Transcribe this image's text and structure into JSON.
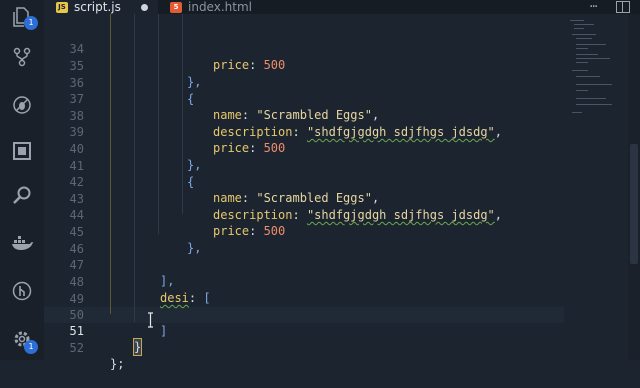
{
  "tabs": [
    {
      "label": "script.js",
      "icon": "js-icon",
      "badge": "JS",
      "active": true,
      "modified": true
    },
    {
      "label": "index.html",
      "icon": "html-icon",
      "badge": "5",
      "active": false
    }
  ],
  "activity_bar": {
    "explorer_badge": "1",
    "settings_badge": "1",
    "icons": [
      "files-icon",
      "source-control-icon",
      "debug-icon",
      "extensions-icon",
      "search-icon",
      "docker-icon",
      "git-lens-icon",
      "settings-gear-icon"
    ]
  },
  "editor": {
    "current_line": "51",
    "lines": [
      {
        "num": "34",
        "indent": 2
      },
      {
        "num": "35",
        "indent": 1
      },
      {
        "num": "36",
        "indent": 1
      },
      {
        "num": "37",
        "indent": 2
      },
      {
        "num": "38",
        "indent": 2
      },
      {
        "num": "39",
        "indent": 2
      },
      {
        "num": "40",
        "indent": 1
      },
      {
        "num": "41",
        "indent": 1
      },
      {
        "num": "42",
        "indent": 2
      },
      {
        "num": "43",
        "indent": 2
      },
      {
        "num": "44",
        "indent": 2
      },
      {
        "num": "45",
        "indent": 1
      },
      {
        "num": "46",
        "indent": 0
      },
      {
        "num": "47",
        "indent": 0
      },
      {
        "num": "48",
        "indent": 0
      },
      {
        "num": "49",
        "indent": 0
      },
      {
        "num": "50",
        "indent": 0
      },
      {
        "num": "51",
        "indent": 0
      },
      {
        "num": "52",
        "indent": 0
      }
    ],
    "tokens": {
      "price_key": "price",
      "price_val": "500",
      "name_key": "name",
      "name_val": "\"Scrambled Eggs\"",
      "desc_key": "description",
      "desc_val": "\"shdfgjgdgh sdjfhgs jdsdg\"",
      "close_obj": "},",
      "open_obj": "{",
      "close_arr": "],",
      "desi_key": "desi",
      "open_arr": "[",
      "close_arr2": "]",
      "close_brace": "}",
      "close_stmt": "};"
    }
  }
}
